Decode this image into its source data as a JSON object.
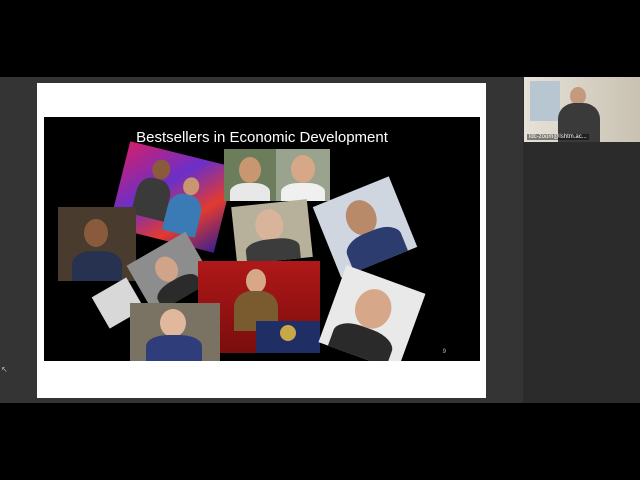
{
  "slide": {
    "title": "Bestsellers in Economic Development",
    "page_number": "9"
  },
  "participant": {
    "label": "ldc-zoom@lshtm.ac..."
  },
  "cursor_glyph": "↖",
  "colors": {
    "background": "#000000",
    "share_area": "#343434",
    "slide_bg": "#ffffff"
  }
}
